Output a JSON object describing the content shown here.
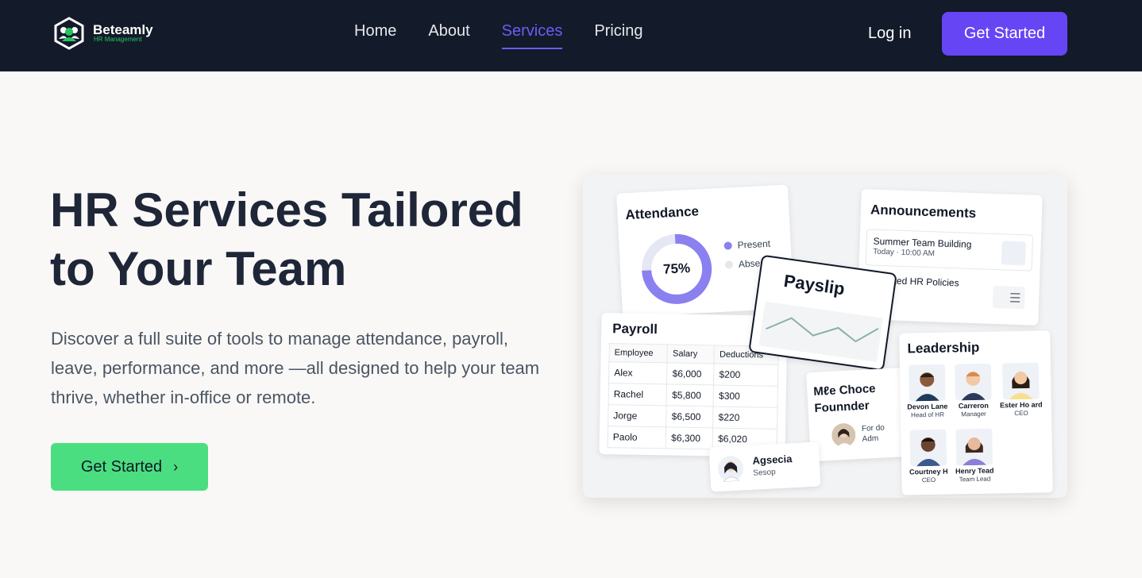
{
  "brand": {
    "name": "Beteamly",
    "tagline": "HR Management"
  },
  "nav": {
    "links": [
      {
        "label": "Home",
        "active": false
      },
      {
        "label": "About",
        "active": false
      },
      {
        "label": "Services",
        "active": true
      },
      {
        "label": "Pricing",
        "active": false
      }
    ],
    "login_label": "Log in",
    "cta_label": "Get Started"
  },
  "hero": {
    "title_line1": "HR Services Tailored",
    "title_line2": "to Your Team",
    "description": "Discover a full suite of tools to manage attendance, payroll, leave, performance, and more —all designed to help your team thrive, whether in-office or remote.",
    "cta_label": "Get Started",
    "cta_icon": "chevron-right-icon"
  },
  "illustration": {
    "attendance": {
      "title": "Attendance",
      "value": "75%",
      "present_fraction": 0.75,
      "legend": [
        {
          "label": "Present",
          "color": "#8b80f0"
        },
        {
          "label": "Absent",
          "color": "#e5e7eb"
        }
      ]
    },
    "announcements": {
      "title": "Announcements",
      "items": [
        {
          "title": "Summer Team Building",
          "sub": "Today · 10:00 AM"
        },
        {
          "title": "Updated HR Policies",
          "sub": ""
        }
      ]
    },
    "payslip": {
      "title": "Payslip"
    },
    "payroll": {
      "title": "Payroll",
      "headers": [
        "Employee",
        "Salary",
        "Deductions"
      ],
      "rows": [
        [
          "Alex",
          "$6,000",
          "$200"
        ],
        [
          "Rachel",
          "$5,800",
          "$300"
        ],
        [
          "Jorge",
          "$6,500",
          "$220"
        ],
        [
          "Paolo",
          "$6,300",
          "$6,020"
        ]
      ]
    },
    "founder": {
      "title_line1": "Mℓe Choce",
      "title_line2": "Founnder",
      "sub_line1": "For do",
      "sub_line2": "Adm"
    },
    "profile": {
      "name": "Agsecia",
      "role": "Sesop"
    },
    "leadership": {
      "title": "Leadership",
      "people": [
        {
          "name": "Devon Lane",
          "role": "Head of HR"
        },
        {
          "name": "Carreron",
          "role": "Manager"
        },
        {
          "name": "Ester Ho ard",
          "role": "CEO"
        },
        {
          "name": "Courtney H",
          "role": "CEO"
        },
        {
          "name": "Henry Tead",
          "role": "Team Lead"
        }
      ]
    }
  },
  "colors": {
    "nav_bg": "#131a2a",
    "accent": "#6645f5",
    "cta_green": "#4ade80",
    "page_bg": "#f9f8f6"
  }
}
